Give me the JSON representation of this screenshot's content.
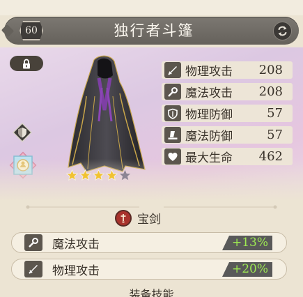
{
  "header": {
    "level": "60",
    "title": "独行者斗篷"
  },
  "preview": {
    "stars_filled": 4,
    "stars_total": 5
  },
  "stats": [
    {
      "icon": "sword-icon",
      "label": "物理攻击",
      "value": "208"
    },
    {
      "icon": "magic-wand-icon",
      "label": "魔法攻击",
      "value": "208"
    },
    {
      "icon": "shield-icon",
      "label": "物理防御",
      "value": "57"
    },
    {
      "icon": "wizard-hat-icon",
      "label": "魔法防御",
      "value": "57"
    },
    {
      "icon": "heart-icon",
      "label": "最大生命",
      "value": "462"
    }
  ],
  "treasure": {
    "icon": "treasure-sword-icon",
    "label": "宝剑"
  },
  "bonuses": [
    {
      "icon": "magic-wand-icon",
      "label": "魔法攻击",
      "value": "+13%"
    },
    {
      "icon": "sword-icon",
      "label": "物理攻击",
      "value": "+20%"
    }
  ],
  "section": {
    "title": "装备技能"
  },
  "colors": {
    "header_bg": "#6f6b65",
    "bonus_value_text": "#9eea52",
    "accent_red": "#a8322c",
    "star_gold": "#f1c232"
  }
}
